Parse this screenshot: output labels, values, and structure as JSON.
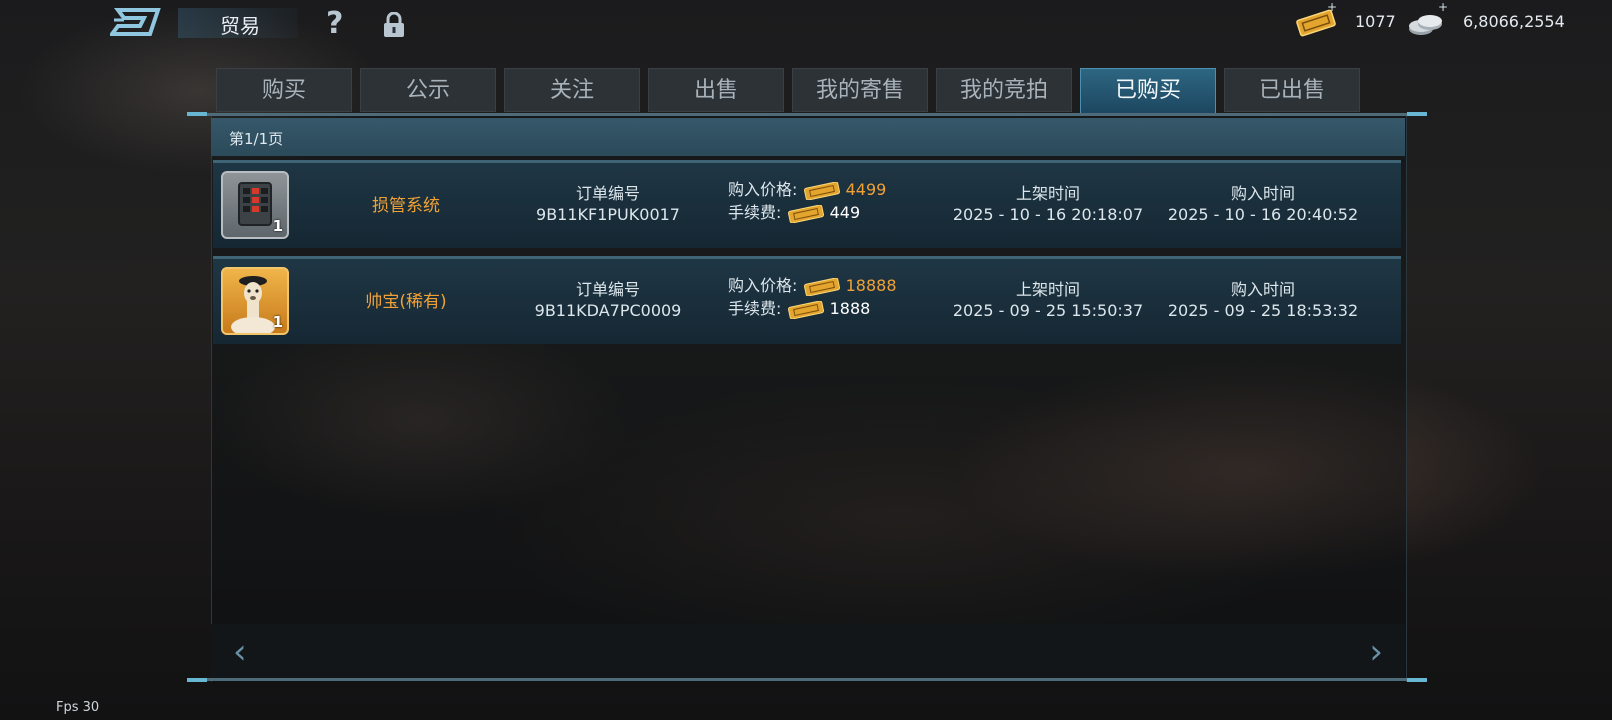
{
  "header": {
    "title": "贸易",
    "ticket_count": "1077",
    "coin_count": "6,8066,2554",
    "plus": "+"
  },
  "tabs": [
    {
      "label": "购买"
    },
    {
      "label": "公示"
    },
    {
      "label": "关注"
    },
    {
      "label": "出售"
    },
    {
      "label": "我的寄售"
    },
    {
      "label": "我的竞拍"
    },
    {
      "label": "已购买",
      "active": true
    },
    {
      "label": "已出售"
    }
  ],
  "page_label": "第1/1页",
  "rows": [
    {
      "name": "损管系统",
      "qty": "1",
      "order_label": "订单编号",
      "order_no": "9B11KF1PUK0017",
      "price_label": "购入价格:",
      "price": "4499",
      "fee_label": "手续费:",
      "fee": "449",
      "list_label": "上架时间",
      "list_time": "2025 - 10 - 16 20:18:07",
      "buy_label": "购入时间",
      "buy_time": "2025 - 10 - 16 20:40:52"
    },
    {
      "name": "帅宝(稀有)",
      "qty": "1",
      "order_label": "订单编号",
      "order_no": "9B11KDA7PC0009",
      "price_label": "购入价格:",
      "price": "18888",
      "fee_label": "手续费:",
      "fee": "1888",
      "list_label": "上架时间",
      "list_time": "2025 - 09 - 25 15:50:37",
      "buy_label": "购入时间",
      "buy_time": "2025 - 09 - 25 18:53:32"
    }
  ],
  "nav": {
    "prev": "‹",
    "next": "›"
  },
  "fps": "Fps 30",
  "colors": {
    "accent": "#f0a135",
    "tab_active": "#2d6681",
    "panel_line": "#67b6d2"
  }
}
